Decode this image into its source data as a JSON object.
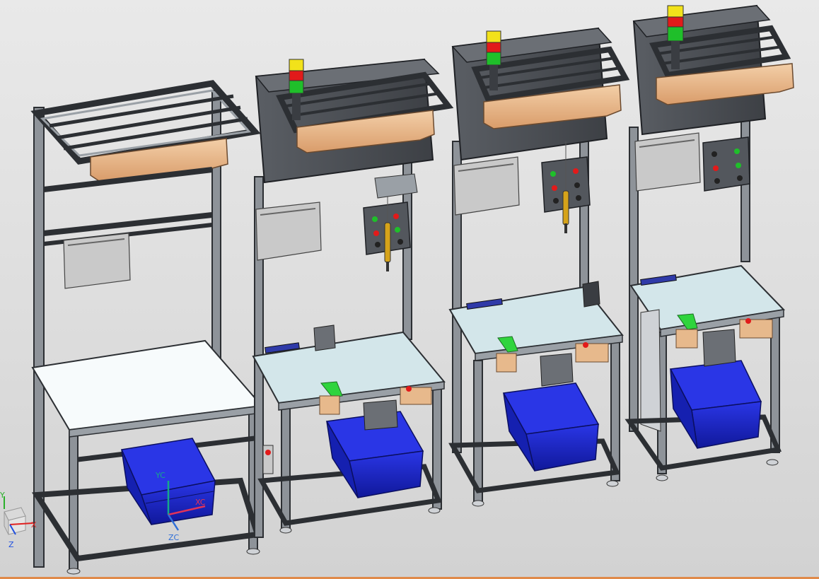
{
  "viewport": {
    "background_top": "#e9e9e9",
    "background_bottom": "#d2d2d2",
    "status_strip_color": "#e08a4a"
  },
  "colors": {
    "frame_aluminum": "#8e9399",
    "frame_dark": "#3a3d42",
    "tabletop_plain": "#f7fbfc",
    "tabletop_esd": "#d3e6ea",
    "light_fixture": "#e7b98c",
    "tote_blue": "#1a25c8",
    "signal_red": "#e21a1a",
    "signal_yellow": "#f2e21a",
    "signal_green": "#1fbf2a",
    "control_box": "#53575d",
    "panel_gray": "#c9c9c9",
    "handle_green": "#2fd43d"
  },
  "workstations": [
    {
      "id": "ws1",
      "has_signal_tower": false,
      "has_control_box": false,
      "has_screwdriver": false,
      "tabletop": "plain"
    },
    {
      "id": "ws2",
      "has_signal_tower": true,
      "has_control_box": true,
      "has_screwdriver": true,
      "tabletop": "esd"
    },
    {
      "id": "ws3",
      "has_signal_tower": true,
      "has_control_box": true,
      "has_screwdriver": true,
      "tabletop": "esd"
    },
    {
      "id": "ws4",
      "has_signal_tower": true,
      "has_control_box": true,
      "has_screwdriver": false,
      "tabletop": "esd"
    }
  ],
  "work_csys": {
    "x_label": "XC",
    "y_label": "YC",
    "z_label": "ZC",
    "x_color": "#e0335a",
    "y_color": "#16a88a",
    "z_color": "#2f6fd8"
  },
  "absolute_triad": {
    "x_label": "X",
    "y_label": "Y",
    "z_label": "Z",
    "x_color": "#e02020",
    "y_color": "#2bb02b",
    "z_color": "#2050e0"
  },
  "icons": [
    "work-coordinate-system-icon",
    "absolute-triad-icon"
  ]
}
